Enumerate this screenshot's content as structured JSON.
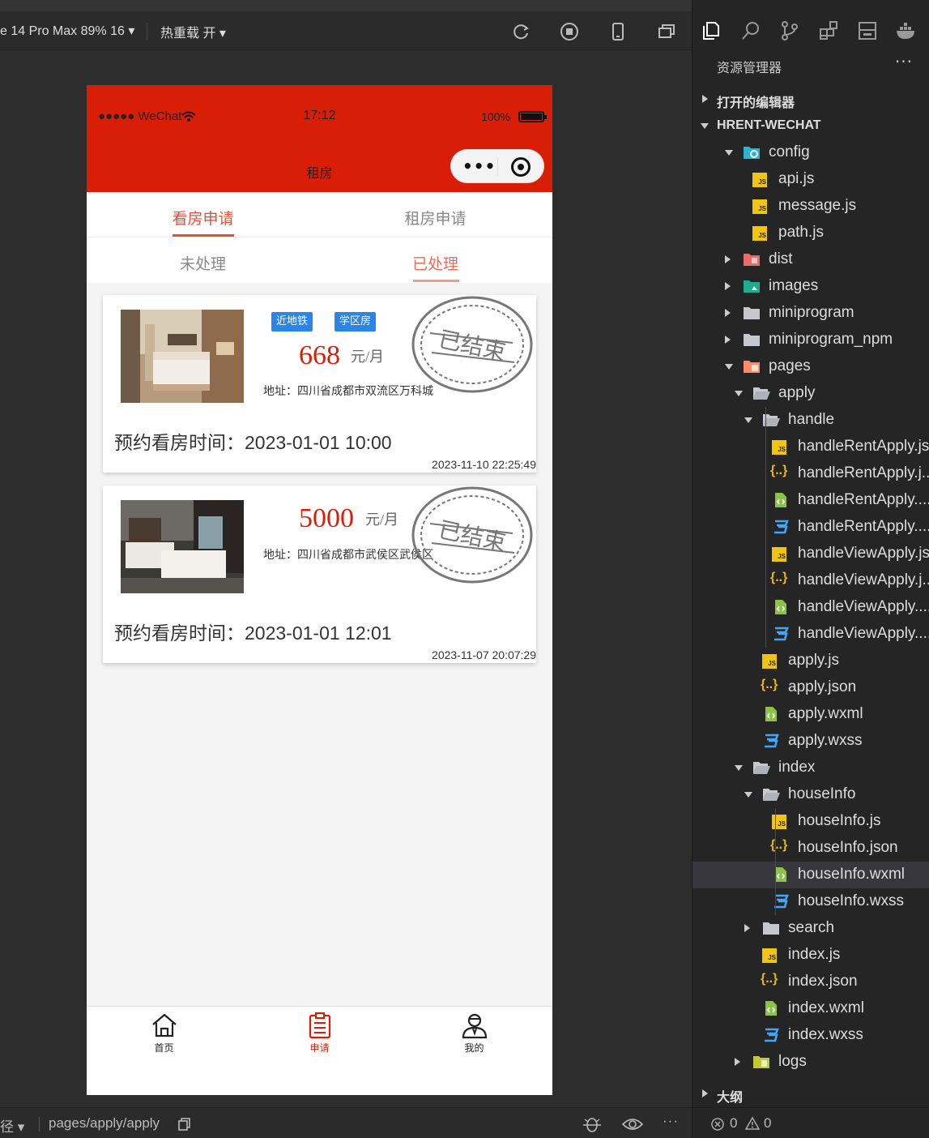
{
  "toolbar": {
    "device": "e 14 Pro Max 89% 16 ▾",
    "hot_reload": "热重载 开 ▾"
  },
  "phone": {
    "status": {
      "carrier": "●●●●● WeChat",
      "time": "17:12",
      "battery": "100%"
    },
    "nav_title": "租房",
    "tabs_primary": [
      {
        "label": "看房申请",
        "active": true
      },
      {
        "label": "租房申请",
        "active": false
      }
    ],
    "tabs_secondary": [
      {
        "label": "未处理",
        "active": false
      },
      {
        "label": "已处理",
        "active": true
      }
    ],
    "cards": [
      {
        "tags": [
          "近地铁",
          "学区房"
        ],
        "price": "668",
        "unit": "元/月",
        "address": "地址：四川省成都市双流区万科城",
        "stamp": "已结束",
        "appointment": "预约看房时间：2023-01-01 10:00",
        "created": "2023-11-10 22:25:49"
      },
      {
        "tags": [],
        "price": "5000",
        "unit": "元/月",
        "address": "地址：四川省成都市武侯区武侯区",
        "stamp": "已结束",
        "appointment": "预约看房时间：2023-01-01 12:01",
        "created": "2023-11-07 20:07:29"
      }
    ],
    "tabbar": [
      {
        "label": "首页",
        "icon": "home-icon",
        "active": false
      },
      {
        "label": "申请",
        "icon": "clipboard-icon",
        "active": true
      },
      {
        "label": "我的",
        "icon": "user-icon",
        "active": false
      }
    ],
    "accent": "#d81e06"
  },
  "bottombar": {
    "left": "径 ▾",
    "path": "pages/apply/apply"
  },
  "explorer": {
    "title": "资源管理器",
    "sections": {
      "open_editors": "打开的编辑器",
      "project": "HRENT-WECHAT",
      "outline": "大纲"
    },
    "tree": [
      {
        "label": "config",
        "type": "folder-config",
        "depth": 1,
        "open": true
      },
      {
        "label": "api.js",
        "type": "js",
        "depth": 2
      },
      {
        "label": "message.js",
        "type": "js",
        "depth": 2
      },
      {
        "label": "path.js",
        "type": "js",
        "depth": 2
      },
      {
        "label": "dist",
        "type": "folder-dist",
        "depth": 1,
        "open": false
      },
      {
        "label": "images",
        "type": "folder-images",
        "depth": 1,
        "open": false
      },
      {
        "label": "miniprogram",
        "type": "folder",
        "depth": 1,
        "open": false
      },
      {
        "label": "miniprogram_npm",
        "type": "folder",
        "depth": 1,
        "open": false
      },
      {
        "label": "pages",
        "type": "folder-pages",
        "depth": 1,
        "open": true
      },
      {
        "label": "apply",
        "type": "folder-open",
        "depth": 2,
        "open": true
      },
      {
        "label": "handle",
        "type": "folder-open",
        "depth": 3,
        "open": true
      },
      {
        "label": "handleRentApply.js",
        "type": "js",
        "depth": 4
      },
      {
        "label": "handleRentApply.j...",
        "type": "json",
        "depth": 4
      },
      {
        "label": "handleRentApply....",
        "type": "wxml",
        "depth": 4
      },
      {
        "label": "handleRentApply....",
        "type": "wxss",
        "depth": 4
      },
      {
        "label": "handleViewApply.js",
        "type": "js",
        "depth": 4
      },
      {
        "label": "handleViewApply.j...",
        "type": "json",
        "depth": 4
      },
      {
        "label": "handleViewApply....",
        "type": "wxml",
        "depth": 4
      },
      {
        "label": "handleViewApply....",
        "type": "wxss",
        "depth": 4
      },
      {
        "label": "apply.js",
        "type": "js",
        "depth": 3
      },
      {
        "label": "apply.json",
        "type": "json",
        "depth": 3
      },
      {
        "label": "apply.wxml",
        "type": "wxml",
        "depth": 3
      },
      {
        "label": "apply.wxss",
        "type": "wxss",
        "depth": 3
      },
      {
        "label": "index",
        "type": "folder-open",
        "depth": 2,
        "open": true
      },
      {
        "label": "houseInfo",
        "type": "folder-open",
        "depth": 3,
        "open": true
      },
      {
        "label": "houseInfo.js",
        "type": "js",
        "depth": 4
      },
      {
        "label": "houseInfo.json",
        "type": "json",
        "depth": 4
      },
      {
        "label": "houseInfo.wxml",
        "type": "wxml",
        "depth": 4,
        "selected": true
      },
      {
        "label": "houseInfo.wxss",
        "type": "wxss",
        "depth": 4
      },
      {
        "label": "search",
        "type": "folder",
        "depth": 3,
        "open": false
      },
      {
        "label": "index.js",
        "type": "js",
        "depth": 3
      },
      {
        "label": "index.json",
        "type": "json",
        "depth": 3
      },
      {
        "label": "index.wxml",
        "type": "wxml",
        "depth": 3
      },
      {
        "label": "index.wxss",
        "type": "wxss",
        "depth": 3
      },
      {
        "label": "logs",
        "type": "folder-logs",
        "depth": 2,
        "open": false
      }
    ],
    "problems": {
      "errors": "0",
      "warnings": "0"
    }
  }
}
